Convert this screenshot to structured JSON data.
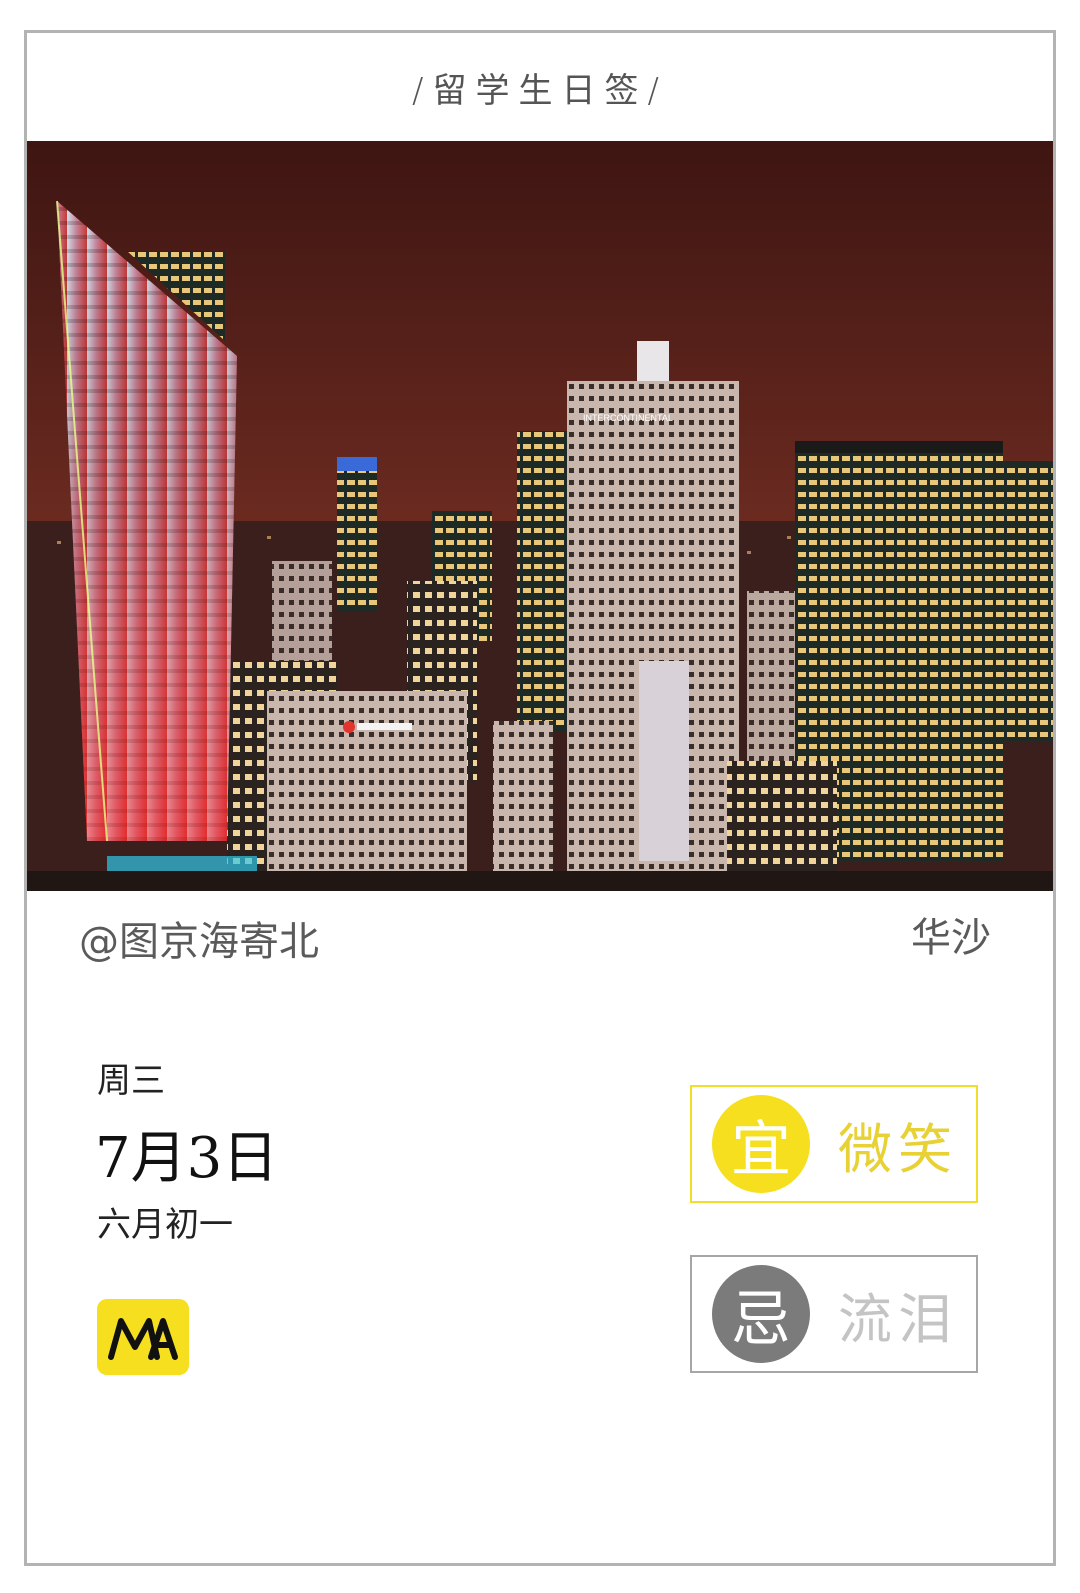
{
  "header": {
    "title": "/留学生日签/"
  },
  "photo": {
    "subject": "night-city-skyline-icon",
    "sign_text": "INTERCONTINENTAL"
  },
  "footer": {
    "credit": "@图京海寄北",
    "city": "华沙",
    "weekday": "周三",
    "date": "7月3日",
    "lunar_date": "六月初一",
    "logo_text": "MA"
  },
  "advice": {
    "do_badge": "宜",
    "do_text": "微笑",
    "dont_badge": "忌",
    "dont_text": "流泪"
  },
  "colors": {
    "accent_yellow": "#f5df1f",
    "gray_badge": "#7b7b7b",
    "border_gray": "#b3b3b3"
  }
}
